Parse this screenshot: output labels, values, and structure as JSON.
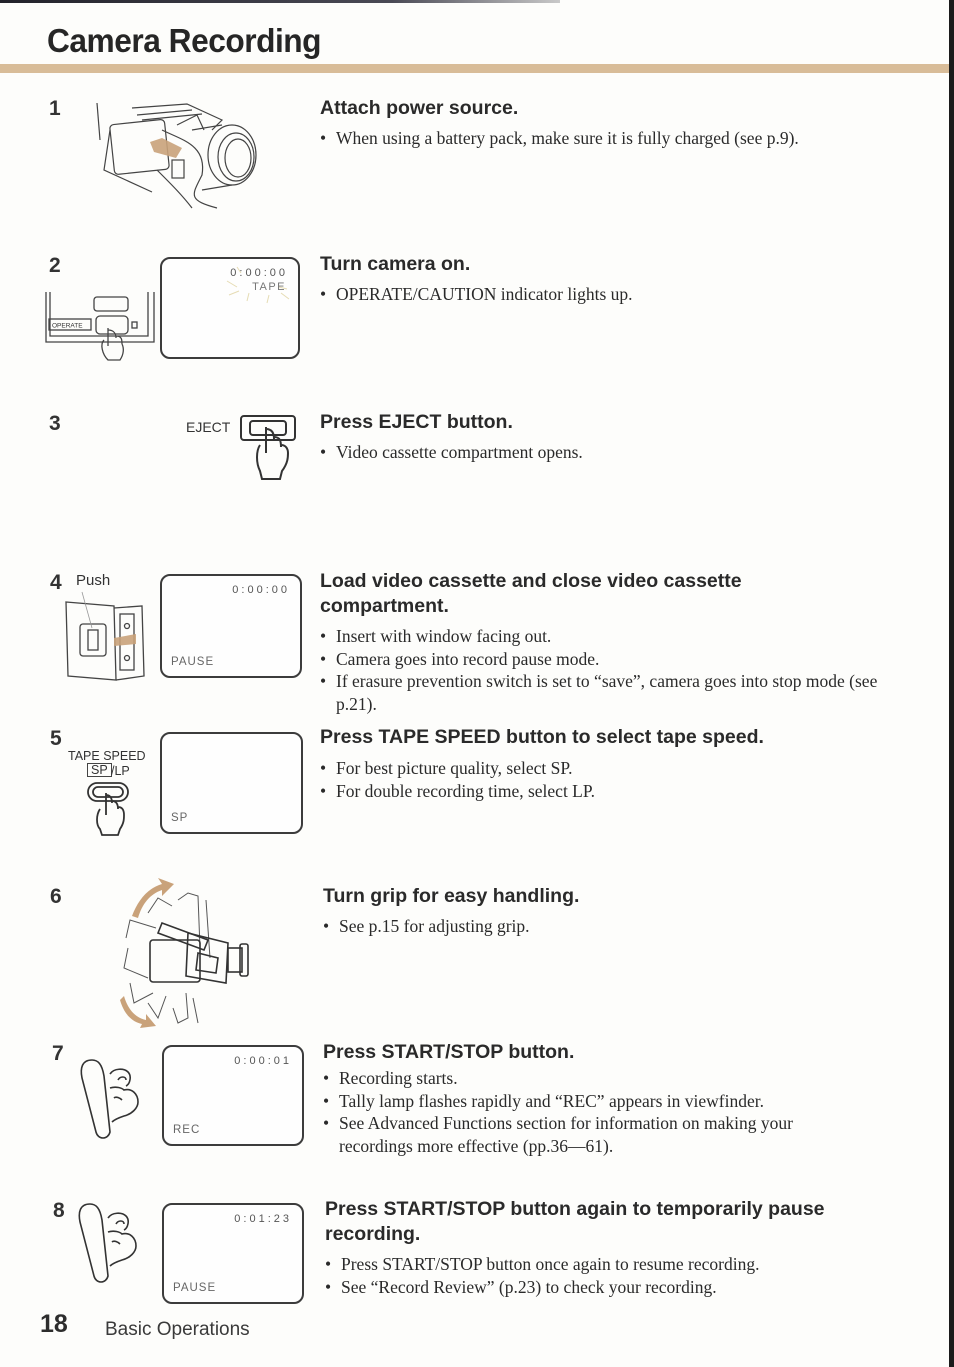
{
  "page": {
    "title": "Camera Recording",
    "accent_color": "#d8bc98",
    "page_number": "18",
    "section": "Basic Operations"
  },
  "steps": [
    {
      "number": "1",
      "heading": "Attach power source.",
      "bullets": [
        "When using a battery pack, make sure it is fully charged (see p.9)."
      ],
      "illustration": "camera-battery-attach"
    },
    {
      "number": "2",
      "heading": "Turn camera on.",
      "bullets": [
        "OPERATE/CAUTION indicator lights up."
      ],
      "illustration": "operate-button-press",
      "button_label": "OPERATE",
      "viewfinder": {
        "counter": "0:00:00",
        "status_top": "TAPE",
        "status_bottom": ""
      }
    },
    {
      "number": "3",
      "heading": "Press EJECT button.",
      "bullets": [
        "Video cassette compartment opens."
      ],
      "illustration": "eject-button-press",
      "button_label": "EJECT"
    },
    {
      "number": "4",
      "heading": "Load video cassette and close video cassette compartment.",
      "bullets": [
        "Insert with window facing out.",
        "Camera goes into record pause mode.",
        "If erasure prevention switch is set to “save”, camera goes into stop mode (see p.21)."
      ],
      "illustration": "cassette-compartment-push",
      "callout": "Push",
      "viewfinder": {
        "counter": "0:00:00",
        "status_bottom": "PAUSE"
      }
    },
    {
      "number": "5",
      "heading": "Press TAPE SPEED button to select tape speed.",
      "bullets": [
        "For best picture quality, select SP.",
        "For double recording time, select LP."
      ],
      "illustration": "tape-speed-button-press",
      "button_label": "TAPE SPEED",
      "button_sub_selected": "SP",
      "button_sub_other": "/LP",
      "viewfinder": {
        "counter": "",
        "status_bottom": "SP"
      }
    },
    {
      "number": "6",
      "heading": "Turn grip for easy handling.",
      "bullets": [
        "See p.15 for adjusting grip."
      ],
      "illustration": "grip-rotation"
    },
    {
      "number": "7",
      "heading": "Press START/STOP button.",
      "bullets": [
        "Recording starts.",
        "Tally lamp flashes rapidly and “REC” appears in viewfinder.",
        "See Advanced Functions section for information on making your recordings more effective (pp.36—61)."
      ],
      "illustration": "start-stop-press",
      "viewfinder": {
        "counter": "0:00:01",
        "status_bottom": "REC"
      }
    },
    {
      "number": "8",
      "heading": "Press START/STOP button again to temporarily pause recording.",
      "bullets": [
        "Press START/STOP button once again to resume recording.",
        "See “Record Review” (p.23) to check your recording."
      ],
      "illustration": "start-stop-press",
      "viewfinder": {
        "counter": "0:01:23",
        "status_bottom": "PAUSE"
      }
    }
  ]
}
